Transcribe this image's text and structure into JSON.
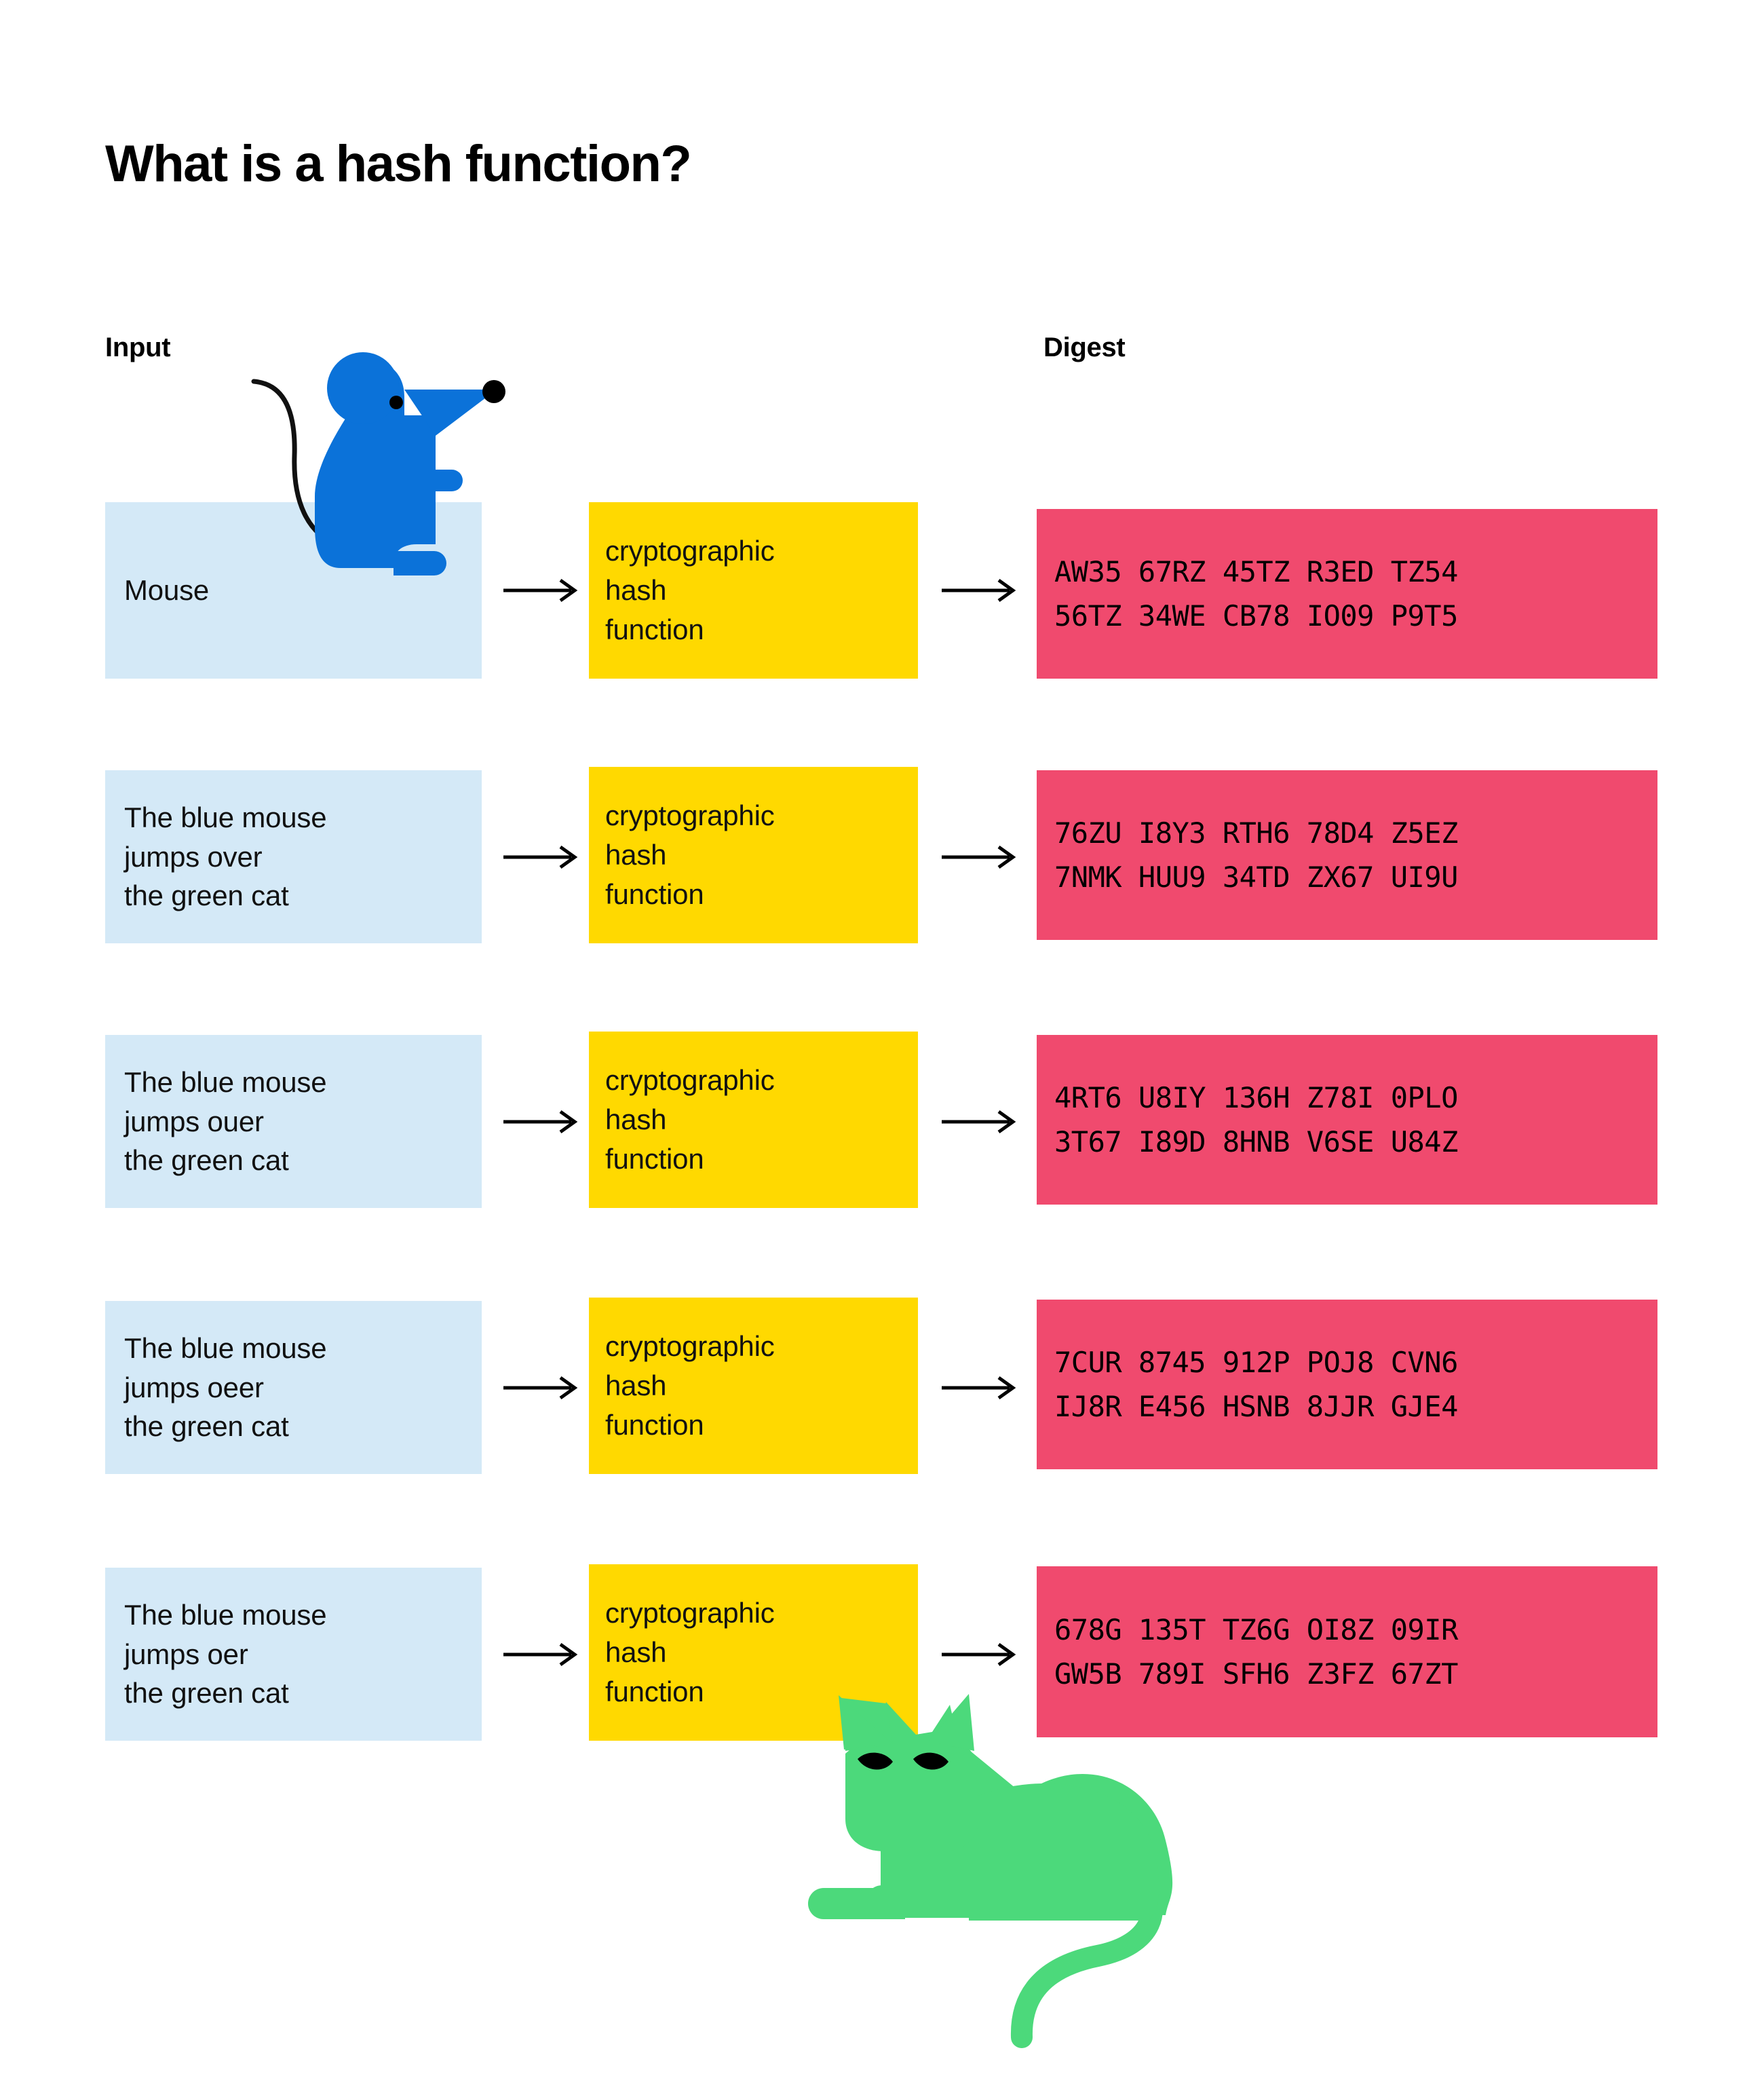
{
  "title": "What is a hash function?",
  "headers": {
    "input": "Input",
    "digest": "Digest"
  },
  "colors": {
    "input_box": "#d4e9f7",
    "function_box": "#ffd900",
    "digest_box": "#f04a6e",
    "mouse": "#0b72d9",
    "cat": "#4cd97b",
    "background": "#ffffff",
    "text": "#000000"
  },
  "function_label": {
    "line1": "cryptographic",
    "line2": "hash",
    "line3": "function"
  },
  "arrow_icon": "arrow-right-icon",
  "illustrations": {
    "mouse": "blue-mouse-illustration",
    "cat": "green-cat-illustration"
  },
  "rows": [
    {
      "input": [
        "Mouse"
      ],
      "digest": [
        "AW35 67RZ 45TZ R3ED TZ54",
        "56TZ 34WE CB78 IO09 P9T5"
      ]
    },
    {
      "input": [
        "The blue mouse",
        "jumps over",
        "the green cat"
      ],
      "digest": [
        "76ZU I8Y3 RTH6 78D4 Z5EZ",
        "7NMK HUU9 34TD ZX67 UI9U"
      ]
    },
    {
      "input": [
        "The blue mouse",
        "jumps ouer",
        "the green cat"
      ],
      "digest": [
        "4RT6 U8IY 136H Z78I 0PLO",
        "3T67 I89D 8HNB V6SE U84Z"
      ]
    },
    {
      "input": [
        "The blue mouse",
        "jumps oeer",
        "the green cat"
      ],
      "digest": [
        "7CUR 8745 912P POJ8 CVN6",
        "IJ8R E456 HSNB 8JJR GJE4"
      ]
    },
    {
      "input": [
        "The blue mouse",
        "jumps oer",
        "the green cat"
      ],
      "digest": [
        "678G 135T TZ6G OI8Z 09IR",
        "GW5B 789I SFH6 Z3FZ 67ZT"
      ]
    }
  ]
}
